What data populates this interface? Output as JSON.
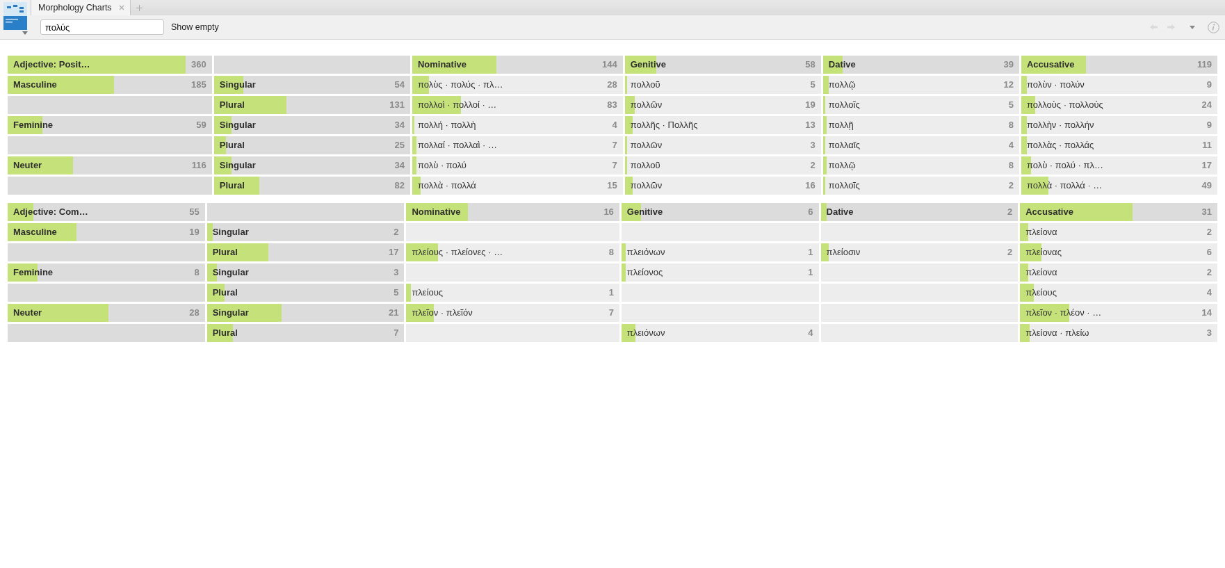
{
  "tabs": [
    {
      "label": "Morphology Charts",
      "selected": true
    }
  ],
  "toolbar": {
    "search": {
      "value": "πολύς"
    },
    "show_empty": "Show empty",
    "back": {
      "disabled": true
    },
    "forward": {
      "disabled": true
    }
  },
  "charts": [
    {
      "title": {
        "label": "Adjective: Posit…",
        "count": "360",
        "level": 0.87
      },
      "cases": [
        {
          "label": "Nominative",
          "count": "144",
          "level": 0.4
        },
        {
          "label": "Genitive",
          "count": "58",
          "level": 0.16
        },
        {
          "label": "Dative",
          "count": "39",
          "level": 0.1
        },
        {
          "label": "Accusative",
          "count": "119",
          "level": 0.33
        }
      ],
      "rows": [
        {
          "gender": {
            "label": "Masculine",
            "count": "185",
            "level": 0.52
          },
          "number": {
            "label": "Singular",
            "count": "54",
            "level": 0.15
          },
          "cells": [
            {
              "text": "πολὺς · πολύς · πλ…",
              "count": "28",
              "level": 0.08
            },
            {
              "text": "πολλοῦ",
              "count": "5",
              "level": 0.01
            },
            {
              "text": "πολλῷ",
              "count": "12",
              "level": 0.03
            },
            {
              "text": "πολὺν · πολύν",
              "count": "9",
              "level": 0.03
            }
          ]
        },
        {
          "gender": null,
          "number": {
            "label": "Plural",
            "count": "131",
            "level": 0.37
          },
          "cells": [
            {
              "text": "πολλοὶ · πολλοί · …",
              "count": "83",
              "level": 0.23
            },
            {
              "text": "πολλῶν",
              "count": "19",
              "level": 0.05
            },
            {
              "text": "πολλοῖς",
              "count": "5",
              "level": 0.01
            },
            {
              "text": "πολλοὺς · πολλούς",
              "count": "24",
              "level": 0.07
            }
          ]
        },
        {
          "gender": {
            "label": "Feminine",
            "count": "59",
            "level": 0.17
          },
          "number": {
            "label": "Singular",
            "count": "34",
            "level": 0.09
          },
          "cells": [
            {
              "text": "πολλή · πολλὴ",
              "count": "4",
              "level": 0.01
            },
            {
              "text": "πολλῆς · Πολλῆς",
              "count": "13",
              "level": 0.04
            },
            {
              "text": "πολλῇ",
              "count": "8",
              "level": 0.02
            },
            {
              "text": "πολλὴν · πολλήν",
              "count": "9",
              "level": 0.03
            }
          ]
        },
        {
          "gender": null,
          "number": {
            "label": "Plural",
            "count": "25",
            "level": 0.06
          },
          "cells": [
            {
              "text": "πολλαί · πολλαὶ · …",
              "count": "7",
              "level": 0.02
            },
            {
              "text": "πολλῶν",
              "count": "3",
              "level": 0.01
            },
            {
              "text": "πολλαῖς",
              "count": "4",
              "level": 0.01
            },
            {
              "text": "πολλὰς · πολλάς",
              "count": "11",
              "level": 0.03
            }
          ]
        },
        {
          "gender": {
            "label": "Neuter",
            "count": "116",
            "level": 0.32
          },
          "number": {
            "label": "Singular",
            "count": "34",
            "level": 0.09
          },
          "cells": [
            {
              "text": "πολὺ · πολύ",
              "count": "7",
              "level": 0.02
            },
            {
              "text": "πολλοῦ",
              "count": "2",
              "level": 0.01
            },
            {
              "text": "πολλῷ",
              "count": "8",
              "level": 0.02
            },
            {
              "text": "πολὺ · πολύ · πλ…",
              "count": "17",
              "level": 0.05
            }
          ]
        },
        {
          "gender": null,
          "number": {
            "label": "Plural",
            "count": "82",
            "level": 0.23
          },
          "cells": [
            {
              "text": "πολλὰ · πολλά",
              "count": "15",
              "level": 0.04
            },
            {
              "text": "πολλῶν",
              "count": "16",
              "level": 0.04
            },
            {
              "text": "πολλοῖς",
              "count": "2",
              "level": 0.01
            },
            {
              "text": "πολλὰ · πολλά · …",
              "count": "49",
              "level": 0.14
            }
          ]
        }
      ]
    },
    {
      "title": {
        "label": "Adjective: Com…",
        "count": "55",
        "level": 0.13
      },
      "cases": [
        {
          "label": "Nominative",
          "count": "16",
          "level": 0.29
        },
        {
          "label": "Genitive",
          "count": "6",
          "level": 0.1
        },
        {
          "label": "Dative",
          "count": "2",
          "level": 0.03
        },
        {
          "label": "Accusative",
          "count": "31",
          "level": 0.57
        }
      ],
      "rows": [
        {
          "gender": {
            "label": "Masculine",
            "count": "19",
            "level": 0.35
          },
          "number": {
            "label": "Singular",
            "count": "2",
            "level": 0.03
          },
          "cells": [
            null,
            null,
            null,
            {
              "text": "πλείονα",
              "count": "2",
              "level": 0.04
            }
          ]
        },
        {
          "gender": null,
          "number": {
            "label": "Plural",
            "count": "17",
            "level": 0.31
          },
          "cells": [
            {
              "text": "πλείους · πλείονες · …",
              "count": "8",
              "level": 0.15
            },
            {
              "text": "πλειόνων",
              "count": "1",
              "level": 0.02
            },
            {
              "text": "πλείοσιν",
              "count": "2",
              "level": 0.04
            },
            {
              "text": "πλείονας",
              "count": "6",
              "level": 0.11
            }
          ]
        },
        {
          "gender": {
            "label": "Feminine",
            "count": "8",
            "level": 0.15
          },
          "number": {
            "label": "Singular",
            "count": "3",
            "level": 0.05
          },
          "cells": [
            null,
            {
              "text": "πλείονος",
              "count": "1",
              "level": 0.02
            },
            null,
            {
              "text": "πλείονα",
              "count": "2",
              "level": 0.04
            }
          ]
        },
        {
          "gender": null,
          "number": {
            "label": "Plural",
            "count": "5",
            "level": 0.09
          },
          "cells": [
            {
              "text": "πλείους",
              "count": "1",
              "level": 0.02
            },
            null,
            null,
            {
              "text": "πλείους",
              "count": "4",
              "level": 0.07
            }
          ]
        },
        {
          "gender": {
            "label": "Neuter",
            "count": "28",
            "level": 0.51
          },
          "number": {
            "label": "Singular",
            "count": "21",
            "level": 0.38
          },
          "cells": [
            {
              "text": "πλεῖον · πλεῖόν",
              "count": "7",
              "level": 0.13
            },
            null,
            null,
            {
              "text": "πλεῖον · πλέον · …",
              "count": "14",
              "level": 0.25
            }
          ]
        },
        {
          "gender": null,
          "number": {
            "label": "Plural",
            "count": "7",
            "level": 0.13
          },
          "cells": [
            null,
            {
              "text": "πλειόνων",
              "count": "4",
              "level": 0.07
            },
            null,
            {
              "text": "πλείονα · πλείω",
              "count": "3",
              "level": 0.05
            }
          ]
        }
      ]
    }
  ]
}
